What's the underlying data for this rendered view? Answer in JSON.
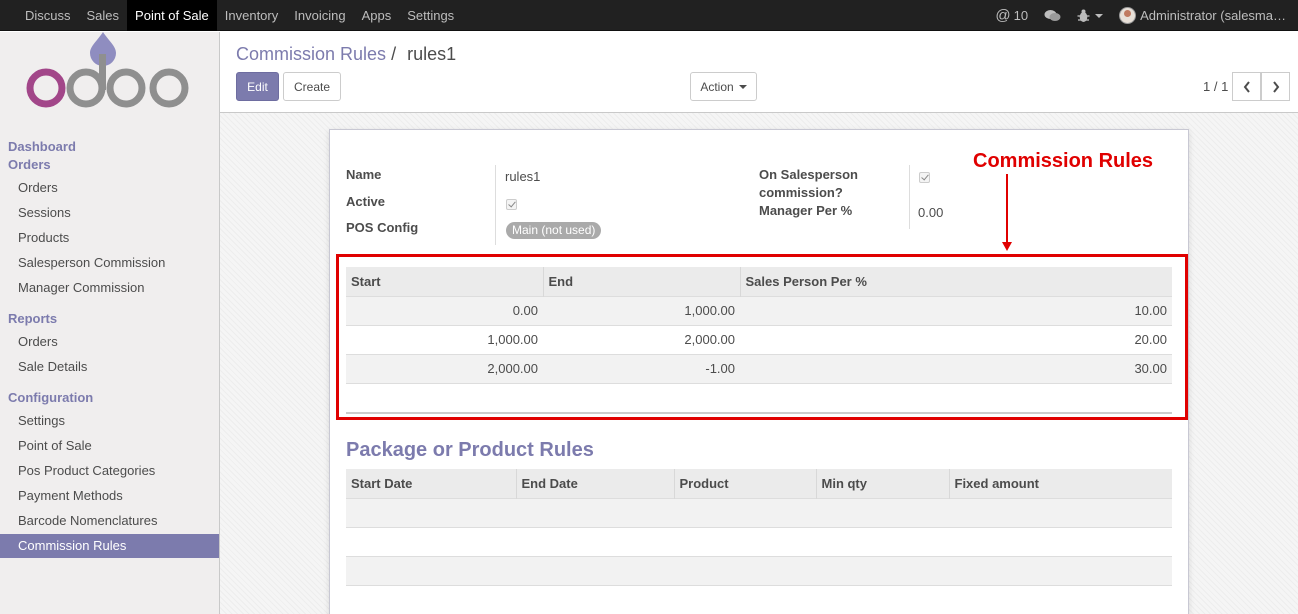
{
  "navbar": {
    "menus": [
      "Discuss",
      "Sales",
      "Point of Sale",
      "Inventory",
      "Invoicing",
      "Apps",
      "Settings"
    ],
    "active_menu": "Point of Sale",
    "messages_count": "10",
    "user": "Administrator (salesma…"
  },
  "sidebar": {
    "dashboard": "Dashboard",
    "orders_head": "Orders",
    "orders_items": [
      "Orders",
      "Sessions",
      "Products",
      "Salesperson Commission",
      "Manager Commission"
    ],
    "reports_head": "Reports",
    "reports_items": [
      "Orders",
      "Sale Details"
    ],
    "config_head": "Configuration",
    "config_items": [
      "Settings",
      "Point of Sale",
      "Pos Product Categories",
      "Payment Methods",
      "Barcode Nomenclatures",
      "Commission Rules"
    ],
    "active_item": "Commission Rules"
  },
  "control": {
    "breadcrumb_parent": "Commission Rules",
    "breadcrumb_sep": "/",
    "breadcrumb_current": "rules1",
    "edit_label": "Edit",
    "create_label": "Create",
    "action_label": "Action",
    "pager": "1 / 1"
  },
  "form": {
    "name_label": "Name",
    "name_value": "rules1",
    "active_label": "Active",
    "active_checked": true,
    "pos_config_label": "POS Config",
    "pos_config_value": "Main (not used)",
    "on_salesperson_label_1": "On Salesperson",
    "on_salesperson_label_2": "commission?",
    "on_salesperson_checked": true,
    "manager_per_label": "Manager Per %",
    "manager_per_value": "0.00"
  },
  "annotation": {
    "text": "Commission Rules",
    "color": "#e00000"
  },
  "commission_table": {
    "headers": [
      "Start",
      "End",
      "Sales Person Per %"
    ],
    "rows": [
      [
        "0.00",
        "1,000.00",
        "10.00"
      ],
      [
        "1,000.00",
        "2,000.00",
        "20.00"
      ],
      [
        "2,000.00",
        "-1.00",
        "30.00"
      ]
    ]
  },
  "package_section": {
    "title": "Package or Product Rules",
    "headers": [
      "Start Date",
      "End Date",
      "Product",
      "Min qty",
      "Fixed amount"
    ]
  },
  "colors": {
    "brand": "#7c7bad",
    "navbar": "#212121",
    "highlight": "#e00000"
  }
}
